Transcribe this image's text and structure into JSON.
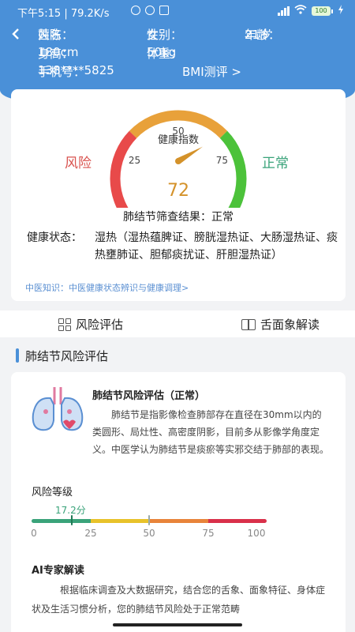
{
  "status_bar": {
    "time_speed": "下午5:15 | 79.2K/s",
    "battery": "100"
  },
  "profile": {
    "name_label": "姓名：",
    "name": "茵陈",
    "gender_label": "性别：",
    "gender": "女",
    "age_label": "年龄：",
    "age": "21岁",
    "height_label": "身高：",
    "height": "180cm",
    "weight_label": "体重：",
    "weight": "50kg",
    "phone_label": "手机号：",
    "phone": "138****5825",
    "bmi_link": "BMI测评 >"
  },
  "gauge": {
    "title": "健康指数",
    "value": 72,
    "value_text": "72",
    "ticks": [
      "0",
      "25",
      "50",
      "75",
      "100"
    ],
    "left_label": "风险",
    "right_label": "正常",
    "colors": {
      "red": "#e84a4a",
      "orange": "#e8a13a",
      "green": "#4cc23a",
      "value": "#d4922a",
      "risk_text": "#d9534f",
      "normal_text": "#3aa37a"
    }
  },
  "screening": {
    "label": "肺结节筛查结果：",
    "result": "正常"
  },
  "health_state": {
    "label": "健康状态：",
    "value": "湿热（湿热蕴脾证、膀胱湿热证、大肠湿热证、痰热壅肺证、胆郁痰扰证、肝胆湿热证）"
  },
  "knowledge_link": "中医知识：中医健康状态辨识与健康调理>",
  "tabs": [
    {
      "label": "风险评估",
      "icon": "grid-icon"
    },
    {
      "label": "舌面象解读",
      "icon": "book-icon"
    }
  ],
  "section_title": "肺结节风险评估",
  "risk_card": {
    "title": "肺结节风险评估（正常）",
    "description": "肺结节是指影像检查肺部存在直径在30mm以内的类圆形、局灶性、高密度阴影，目前多从影像学角度定义。中医学认为肺结节是痰瘀等实邪交结于肺部的表现。",
    "level_label": "风险等级",
    "score_text": "17.2分",
    "score": 17.2,
    "scale_ticks": [
      "0",
      "25",
      "50",
      "75",
      "100"
    ],
    "scale_colors": [
      "#3aa37a",
      "#e8c22a",
      "#e8843a",
      "#d9304a"
    ],
    "ai_label": "AI专家解读",
    "ai_text": "根据临床调查及大数据研究，结合您的舌象、面象特征、身体症状及生活习惯分析，您的肺结节风险处于正常范畴"
  }
}
